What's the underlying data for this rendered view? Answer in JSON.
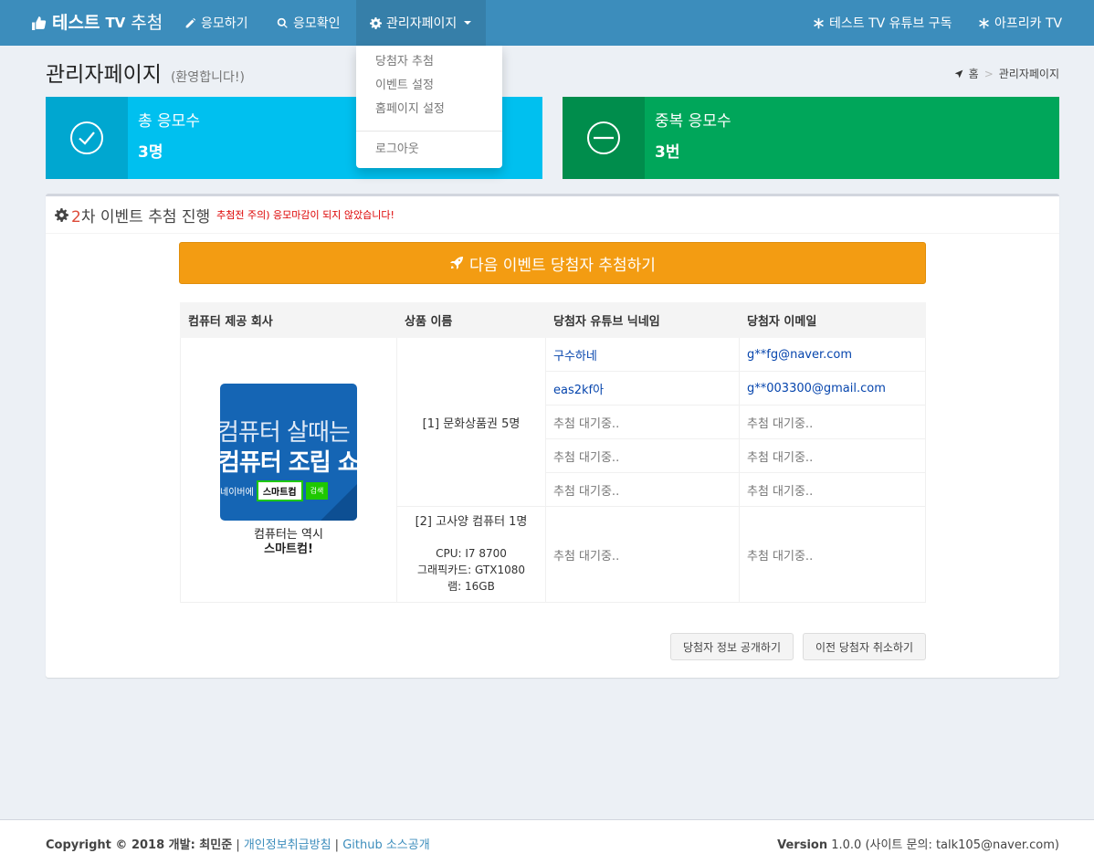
{
  "navbar": {
    "brand_main": "테스트",
    "brand_tv": "TV",
    "brand_suffix": "추첨",
    "apply": "응모하기",
    "check": "응모확인",
    "admin": "관리자페이지",
    "youtube": "테스트 TV 유튜브 구독",
    "afreeca": "아프리카 TV"
  },
  "dropdown": {
    "items": [
      "당첨자 추첨",
      "이벤트 설정",
      "홈페이지 설정"
    ],
    "logout": "로그아웃"
  },
  "header": {
    "title": "관리자페이지",
    "subtitle": "(환영합니다!)",
    "breadcrumb_home": "홈",
    "breadcrumb_sep": ">",
    "breadcrumb_current": "관리자페이지"
  },
  "info_boxes": {
    "total_label": "총 응모수",
    "total_value": "3명",
    "dup_label": "중복 응모수",
    "dup_value": "3번"
  },
  "event": {
    "round": "2",
    "title": "차 이벤트 추첨 진행",
    "warning": "추첨전 주의) 응모마감이 되지 않았습니다!",
    "draw_button": "다음 이벤트 당첨자 추첨하기"
  },
  "table": {
    "headers": [
      "컴퓨터 제공 회사",
      "상품 이름",
      "당첨자 유튜브 닉네임",
      "당첨자 이메일"
    ],
    "banner_line1": "컴퓨터 살때는",
    "banner_line2": "컴퓨터 조립 쇼",
    "banner_naver": "네이버에",
    "banner_search": "스마트컴",
    "banner_btn": "검색",
    "sponsor_caption1": "컴퓨터는 역시",
    "sponsor_caption2": "스마트컴!",
    "prize1": "[1] 문화상품권 5명",
    "prize2_title": "[2] 고사양 컴퓨터 1명",
    "prize2_cpu": "CPU: I7 8700",
    "prize2_gpu": "그래픽카드: GTX1080",
    "prize2_ram": "램: 16GB",
    "rows": [
      {
        "nick": "구수하네",
        "email": "g**fg@naver.com"
      },
      {
        "nick": "eas2kf아",
        "email": "g**003300@gmail.com"
      },
      {
        "nick": "추첨 대기중..",
        "email": "추첨 대기중.."
      },
      {
        "nick": "추첨 대기중..",
        "email": "추첨 대기중.."
      },
      {
        "nick": "추첨 대기중..",
        "email": "추첨 대기중.."
      },
      {
        "nick": "추첨 대기중..",
        "email": "추첨 대기중.."
      }
    ]
  },
  "buttons": {
    "publish": "당첨자 정보 공개하기",
    "cancel": "이전 당첨자 취소하기"
  },
  "footer": {
    "copyright": "Copyright © 2018 개발: 최민준",
    "privacy": "개인정보취급방침",
    "github": "Github 소스공개",
    "version_label": "Version",
    "version_rest": "1.0.0 (사이트 문의: talk105@naver.com)"
  },
  "colors": {
    "navbar": "#3c8dbc",
    "aqua": "#00c0ef",
    "green": "#00a65a",
    "orange": "#f39c12"
  }
}
